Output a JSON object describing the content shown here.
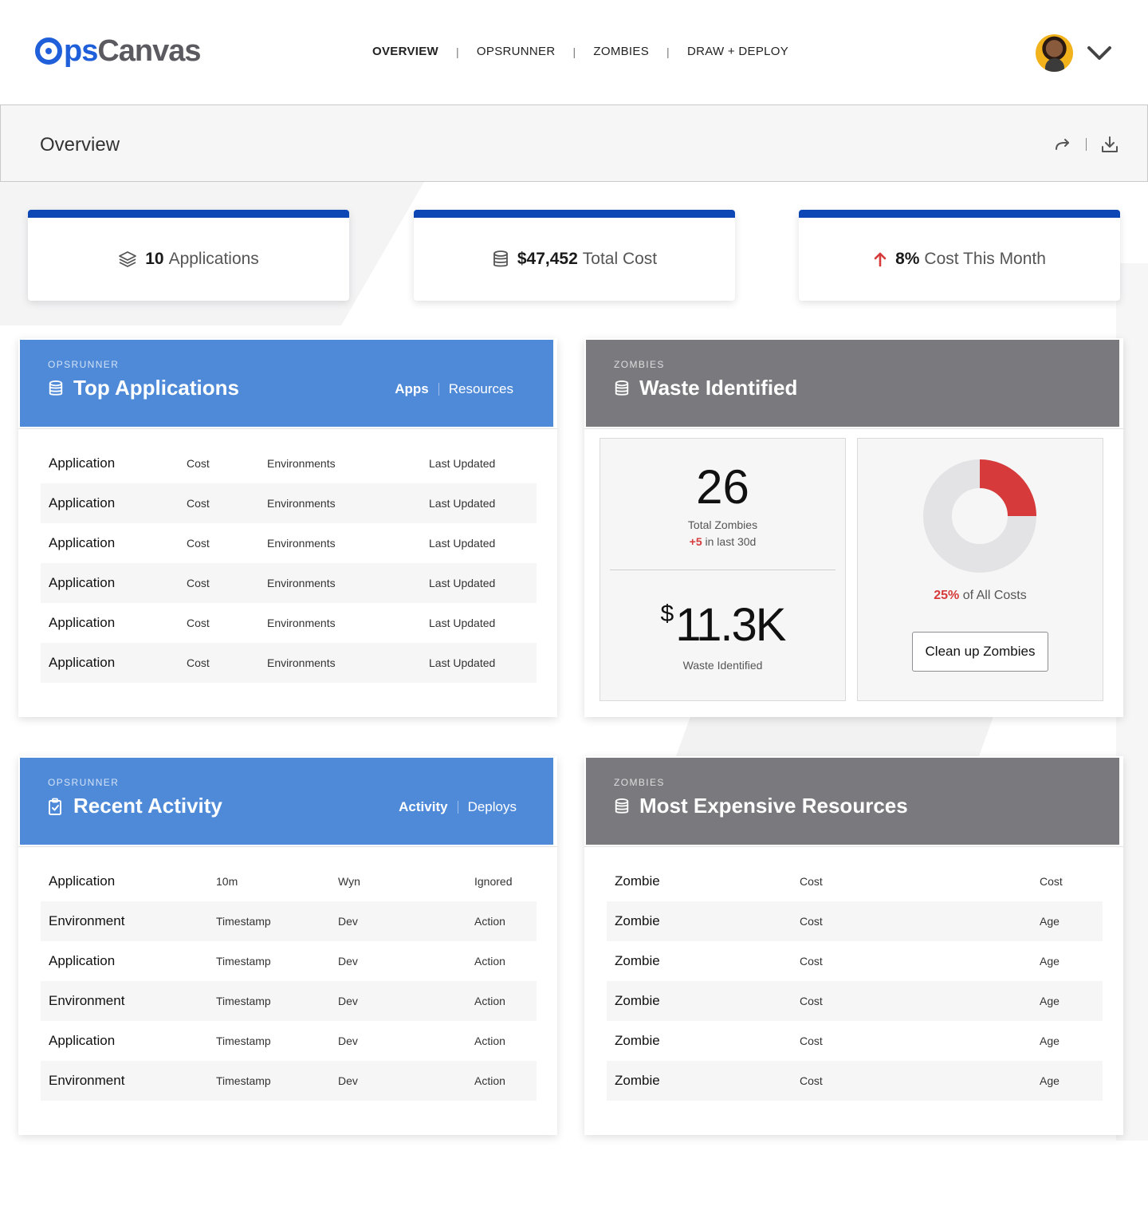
{
  "app": {
    "logo_ops": "ps",
    "logo_canvas": "Canvas",
    "brand_color": "#1f5fd9"
  },
  "nav": {
    "items": [
      "OVERVIEW",
      "OPSRUNNER",
      "ZOMBIES",
      "DRAW + DEPLOY"
    ],
    "active": "OVERVIEW"
  },
  "overview": {
    "title": "Overview",
    "share_icon": "share-arrow-icon",
    "download_icon": "download-icon"
  },
  "stats": [
    {
      "icon": "layers-icon",
      "value": "10",
      "label": "Applications"
    },
    {
      "icon": "database-icon",
      "value": "$47,452",
      "label": "Total Cost"
    },
    {
      "icon": "arrow-up-icon",
      "value": "8%",
      "label": "Cost This Month"
    }
  ],
  "top_apps": {
    "eyebrow": "OPSRUNNER",
    "title": "Top Applications",
    "tabs": [
      "Apps",
      "Resources"
    ],
    "rows": [
      [
        "Application",
        "Cost",
        "Environments",
        "Last Updated"
      ],
      [
        "Application",
        "Cost",
        "Environments",
        "Last Updated"
      ],
      [
        "Application",
        "Cost",
        "Environments",
        "Last Updated"
      ],
      [
        "Application",
        "Cost",
        "Environments",
        "Last Updated"
      ],
      [
        "Application",
        "Cost",
        "Environments",
        "Last Updated"
      ],
      [
        "Application",
        "Cost",
        "Environments",
        "Last Updated"
      ]
    ]
  },
  "waste": {
    "eyebrow": "ZOMBIES",
    "title": "Waste Identified",
    "total_zombies": "26",
    "total_zombies_label": "Total Zombies",
    "delta": "+5",
    "delta_label": "in last 30d",
    "currency": "$",
    "amount": "11.3K",
    "amount_label": "Waste Identified",
    "pct": "25%",
    "pct_label": "of All Costs",
    "pct_value": 0.25,
    "button": "Clean up Zombies",
    "accent": "#d63a3a"
  },
  "recent": {
    "eyebrow": "OPSRUNNER",
    "title": "Recent Activity",
    "tabs": [
      "Activity",
      "Deploys"
    ],
    "rows": [
      [
        "Application",
        "10m",
        "Wyn",
        "Ignored"
      ],
      [
        "Environment",
        "Timestamp",
        "Dev",
        "Action"
      ],
      [
        "Application",
        "Timestamp",
        "Dev",
        "Action"
      ],
      [
        "Environment",
        "Timestamp",
        "Dev",
        "Action"
      ],
      [
        "Application",
        "Timestamp",
        "Dev",
        "Action"
      ],
      [
        "Environment",
        "Timestamp",
        "Dev",
        "Action"
      ]
    ]
  },
  "expensive": {
    "eyebrow": "ZOMBIES",
    "title": "Most Expensive Resources",
    "rows": [
      [
        "Zombie",
        "Cost",
        "Cost"
      ],
      [
        "Zombie",
        "Cost",
        "Age"
      ],
      [
        "Zombie",
        "Cost",
        "Age"
      ],
      [
        "Zombie",
        "Cost",
        "Age"
      ],
      [
        "Zombie",
        "Cost",
        "Age"
      ],
      [
        "Zombie",
        "Cost",
        "Age"
      ]
    ]
  }
}
